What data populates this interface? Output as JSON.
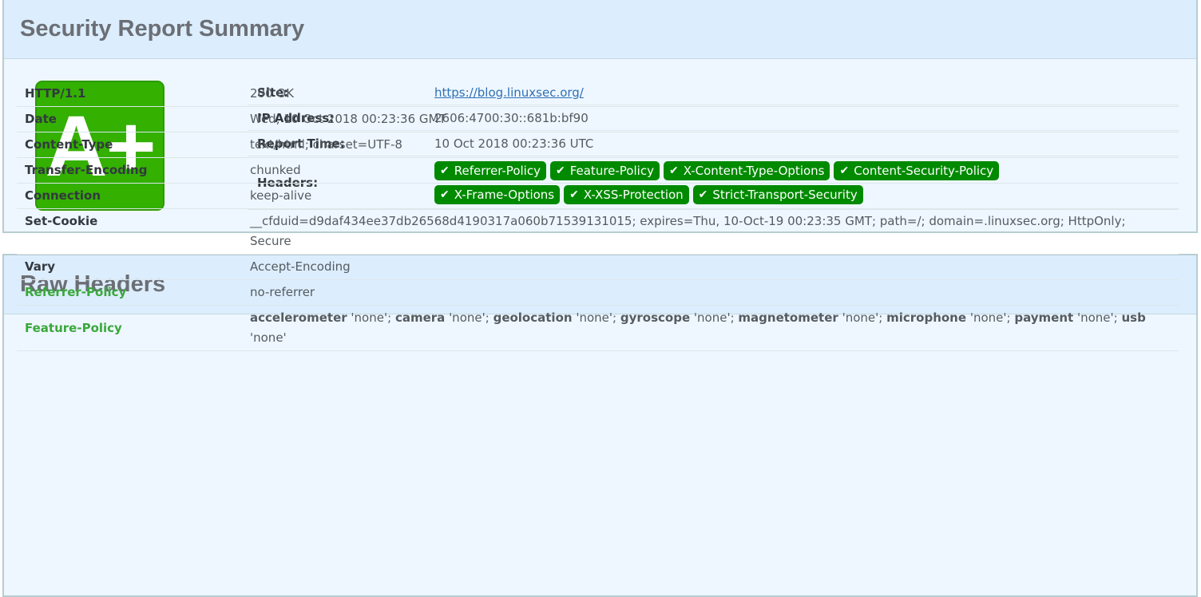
{
  "summary": {
    "title": "Security Report Summary",
    "grade": "A+",
    "site_label": "Site:",
    "site_value": "https://blog.linuxsec.org/",
    "ip_label": "IP Address:",
    "ip_value": "2606:4700:30::681b:bf90",
    "time_label": "Report Time:",
    "time_value": "10 Oct 2018 00:23:36 UTC",
    "headers_label": "Headers:",
    "check_glyph": "✔",
    "badges": [
      "Referrer-Policy",
      "Feature-Policy",
      "X-Content-Type-Options",
      "Content-Security-Policy",
      "X-Frame-Options",
      "X-XSS-Protection",
      "Strict-Transport-Security"
    ]
  },
  "raw": {
    "title": "Raw Headers",
    "rows": [
      {
        "name": "HTTP/1.1",
        "value": "200 OK"
      },
      {
        "name": "Date",
        "value": "Wed, 10 Oct 2018 00:23:36 GMT"
      },
      {
        "name": "Content-Type",
        "value": "text/html; charset=UTF-8"
      },
      {
        "name": "Transfer-Encoding",
        "value": "chunked"
      },
      {
        "name": "Connection",
        "value": "keep-alive"
      },
      {
        "name": "Set-Cookie",
        "value": "__cfduid=d9daf434ee37db26568d4190317a060b71539131015; expires=Thu, 10-Oct-19 00:23:35 GMT; path=/; domain=.linuxsec.org; HttpOnly; Secure"
      },
      {
        "name": "Vary",
        "value": "Accept-Encoding"
      },
      {
        "name": "Referrer-Policy",
        "value": "no-referrer"
      }
    ],
    "feature_policy": {
      "name": "Feature-Policy",
      "items": [
        {
          "feature": "accelerometer",
          "value": "'none';"
        },
        {
          "feature": "camera",
          "value": "'none';"
        },
        {
          "feature": "geolocation",
          "value": "'none';"
        },
        {
          "feature": "gyroscope",
          "value": "'none';"
        },
        {
          "feature": "magnetometer",
          "value": "'none';"
        },
        {
          "feature": "microphone",
          "value": "'none';"
        },
        {
          "feature": "payment",
          "value": "'none';"
        },
        {
          "feature": "usb",
          "value": "'none'"
        }
      ]
    }
  },
  "colors": {
    "grade_green": "#33b000",
    "badge_green": "#008a00",
    "good_header_green": "#3aa83a",
    "link_blue": "#2f6fb5"
  }
}
